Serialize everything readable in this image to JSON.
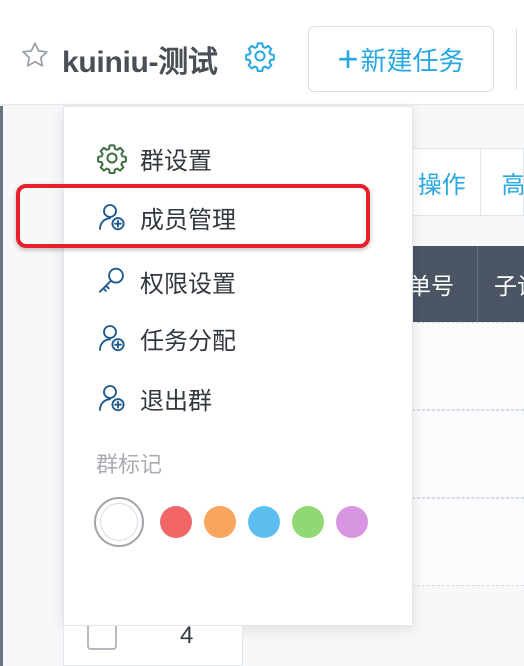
{
  "header": {
    "title": "kuiniu-测试",
    "new_task_label": "新建任务",
    "new_task_plus": "+"
  },
  "toolbar": {
    "operations_label": "操作",
    "advanced_label": "高"
  },
  "table": {
    "headers": [
      "单号",
      "子记"
    ],
    "visible_row_number": "4"
  },
  "menu": {
    "items": [
      {
        "label": "群设置",
        "icon": "gear-icon"
      },
      {
        "label": "成员管理",
        "icon": "user-add-icon"
      },
      {
        "label": "权限设置",
        "icon": "key-icon"
      },
      {
        "label": "任务分配",
        "icon": "user-add-icon"
      },
      {
        "label": "退出群",
        "icon": "user-add-icon"
      }
    ],
    "highlighted_item": "成员管理",
    "tag_section_label": "群标记",
    "tag_colors": [
      "#f16567",
      "#f9a45c",
      "#5dbef0",
      "#8fd873",
      "#d896e2"
    ]
  },
  "colors": {
    "accent": "#27a8e2",
    "highlight": "#e5202a",
    "table_header_bg": "#4b5564"
  }
}
